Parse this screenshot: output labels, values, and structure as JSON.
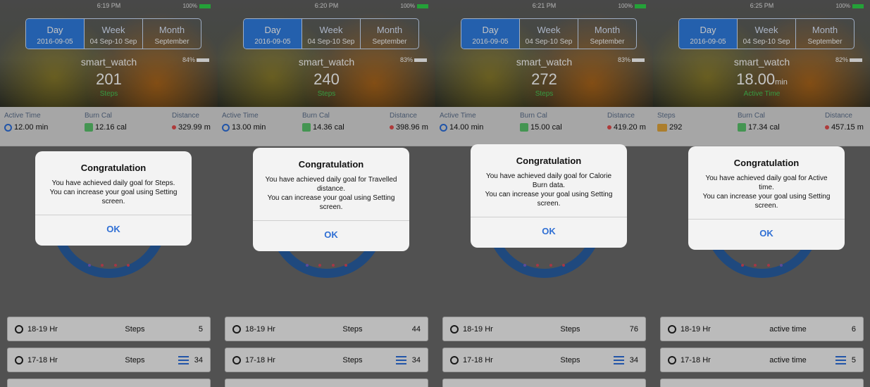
{
  "screens": [
    {
      "status_time": "6:19 PM",
      "battery_percent": "100%",
      "tabs": [
        {
          "label": "Day",
          "sub": "2016-09-05"
        },
        {
          "label": "Week",
          "sub": "04 Sep-10 Sep"
        },
        {
          "label": "Month",
          "sub": "September"
        }
      ],
      "device_name": "smart_watch",
      "device_battery": "84%",
      "main_value": "201",
      "main_unit": "",
      "main_label": "Steps",
      "metrics": [
        {
          "label": "Active Time",
          "value": "12.00 min",
          "icon": "clock-icon"
        },
        {
          "label": "Burn Cal",
          "value": "12.16 cal",
          "icon": "flame-icon"
        },
        {
          "label": "Distance",
          "value": "329.99 m",
          "icon": "location-pin-icon"
        }
      ],
      "dialog": {
        "title": "Congratulation",
        "message": "You have achieved daily goal for Steps.\nYou can increase your goal using Setting screen.",
        "ok": "OK"
      },
      "rows": [
        {
          "hour": "18-19 Hr",
          "kind": "Steps",
          "count": "5"
        },
        {
          "hour": "17-18 Hr",
          "kind": "Steps",
          "count": "34"
        }
      ]
    },
    {
      "status_time": "6:20 PM",
      "battery_percent": "100%",
      "tabs": [
        {
          "label": "Day",
          "sub": "2016-09-05"
        },
        {
          "label": "Week",
          "sub": "04 Sep-10 Sep"
        },
        {
          "label": "Month",
          "sub": "September"
        }
      ],
      "device_name": "smart_watch",
      "device_battery": "83%",
      "main_value": "240",
      "main_unit": "",
      "main_label": "Steps",
      "metrics": [
        {
          "label": "Active Time",
          "value": "13.00 min",
          "icon": "clock-icon"
        },
        {
          "label": "Burn Cal",
          "value": "14.36 cal",
          "icon": "flame-icon"
        },
        {
          "label": "Distance",
          "value": "398.96 m",
          "icon": "location-pin-icon"
        }
      ],
      "dialog": {
        "title": "Congratulation",
        "message": "You have achieved daily goal for Travelled distance.\nYou can increase your goal using Setting screen.",
        "ok": "OK"
      },
      "rows": [
        {
          "hour": "18-19 Hr",
          "kind": "Steps",
          "count": "44"
        },
        {
          "hour": "17-18 Hr",
          "kind": "Steps",
          "count": "34"
        }
      ]
    },
    {
      "status_time": "6:21 PM",
      "battery_percent": "100%",
      "tabs": [
        {
          "label": "Day",
          "sub": "2016-09-05"
        },
        {
          "label": "Week",
          "sub": "04 Sep-10 Sep"
        },
        {
          "label": "Month",
          "sub": "September"
        }
      ],
      "device_name": "smart_watch",
      "device_battery": "83%",
      "main_value": "272",
      "main_unit": "",
      "main_label": "Steps",
      "metrics": [
        {
          "label": "Active Time",
          "value": "14.00 min",
          "icon": "clock-icon"
        },
        {
          "label": "Burn Cal",
          "value": "15.00 cal",
          "icon": "flame-icon"
        },
        {
          "label": "Distance",
          "value": "419.20 m",
          "icon": "location-pin-icon"
        }
      ],
      "dialog": {
        "title": "Congratulation",
        "message": "You have achieved daily goal for Calorie Burn data.\nYou can increase your goal using Setting screen.",
        "ok": "OK"
      },
      "rows": [
        {
          "hour": "18-19 Hr",
          "kind": "Steps",
          "count": "76"
        },
        {
          "hour": "17-18 Hr",
          "kind": "Steps",
          "count": "34"
        }
      ]
    },
    {
      "status_time": "6:25 PM",
      "battery_percent": "100%",
      "tabs": [
        {
          "label": "Day",
          "sub": "2016-09-05"
        },
        {
          "label": "Week",
          "sub": "04 Sep-10 Sep"
        },
        {
          "label": "Month",
          "sub": "September"
        }
      ],
      "device_name": "smart_watch",
      "device_battery": "82%",
      "main_value": "18.00",
      "main_unit": "min",
      "main_label": "Active Time",
      "metrics": [
        {
          "label": "Steps",
          "value": "292",
          "icon": "shoe-icon"
        },
        {
          "label": "Burn Cal",
          "value": "17.34 cal",
          "icon": "flame-icon"
        },
        {
          "label": "Distance",
          "value": "457.15 m",
          "icon": "location-pin-icon"
        }
      ],
      "dialog": {
        "title": "Congratulation",
        "message": "You have achieved daily goal for Active time.\nYou can increase your goal using Setting screen.",
        "ok": "OK"
      },
      "rows": [
        {
          "hour": "18-19 Hr",
          "kind": "active time",
          "count": "6"
        },
        {
          "hour": "17-18 Hr",
          "kind": "active time",
          "count": "5"
        }
      ]
    }
  ]
}
